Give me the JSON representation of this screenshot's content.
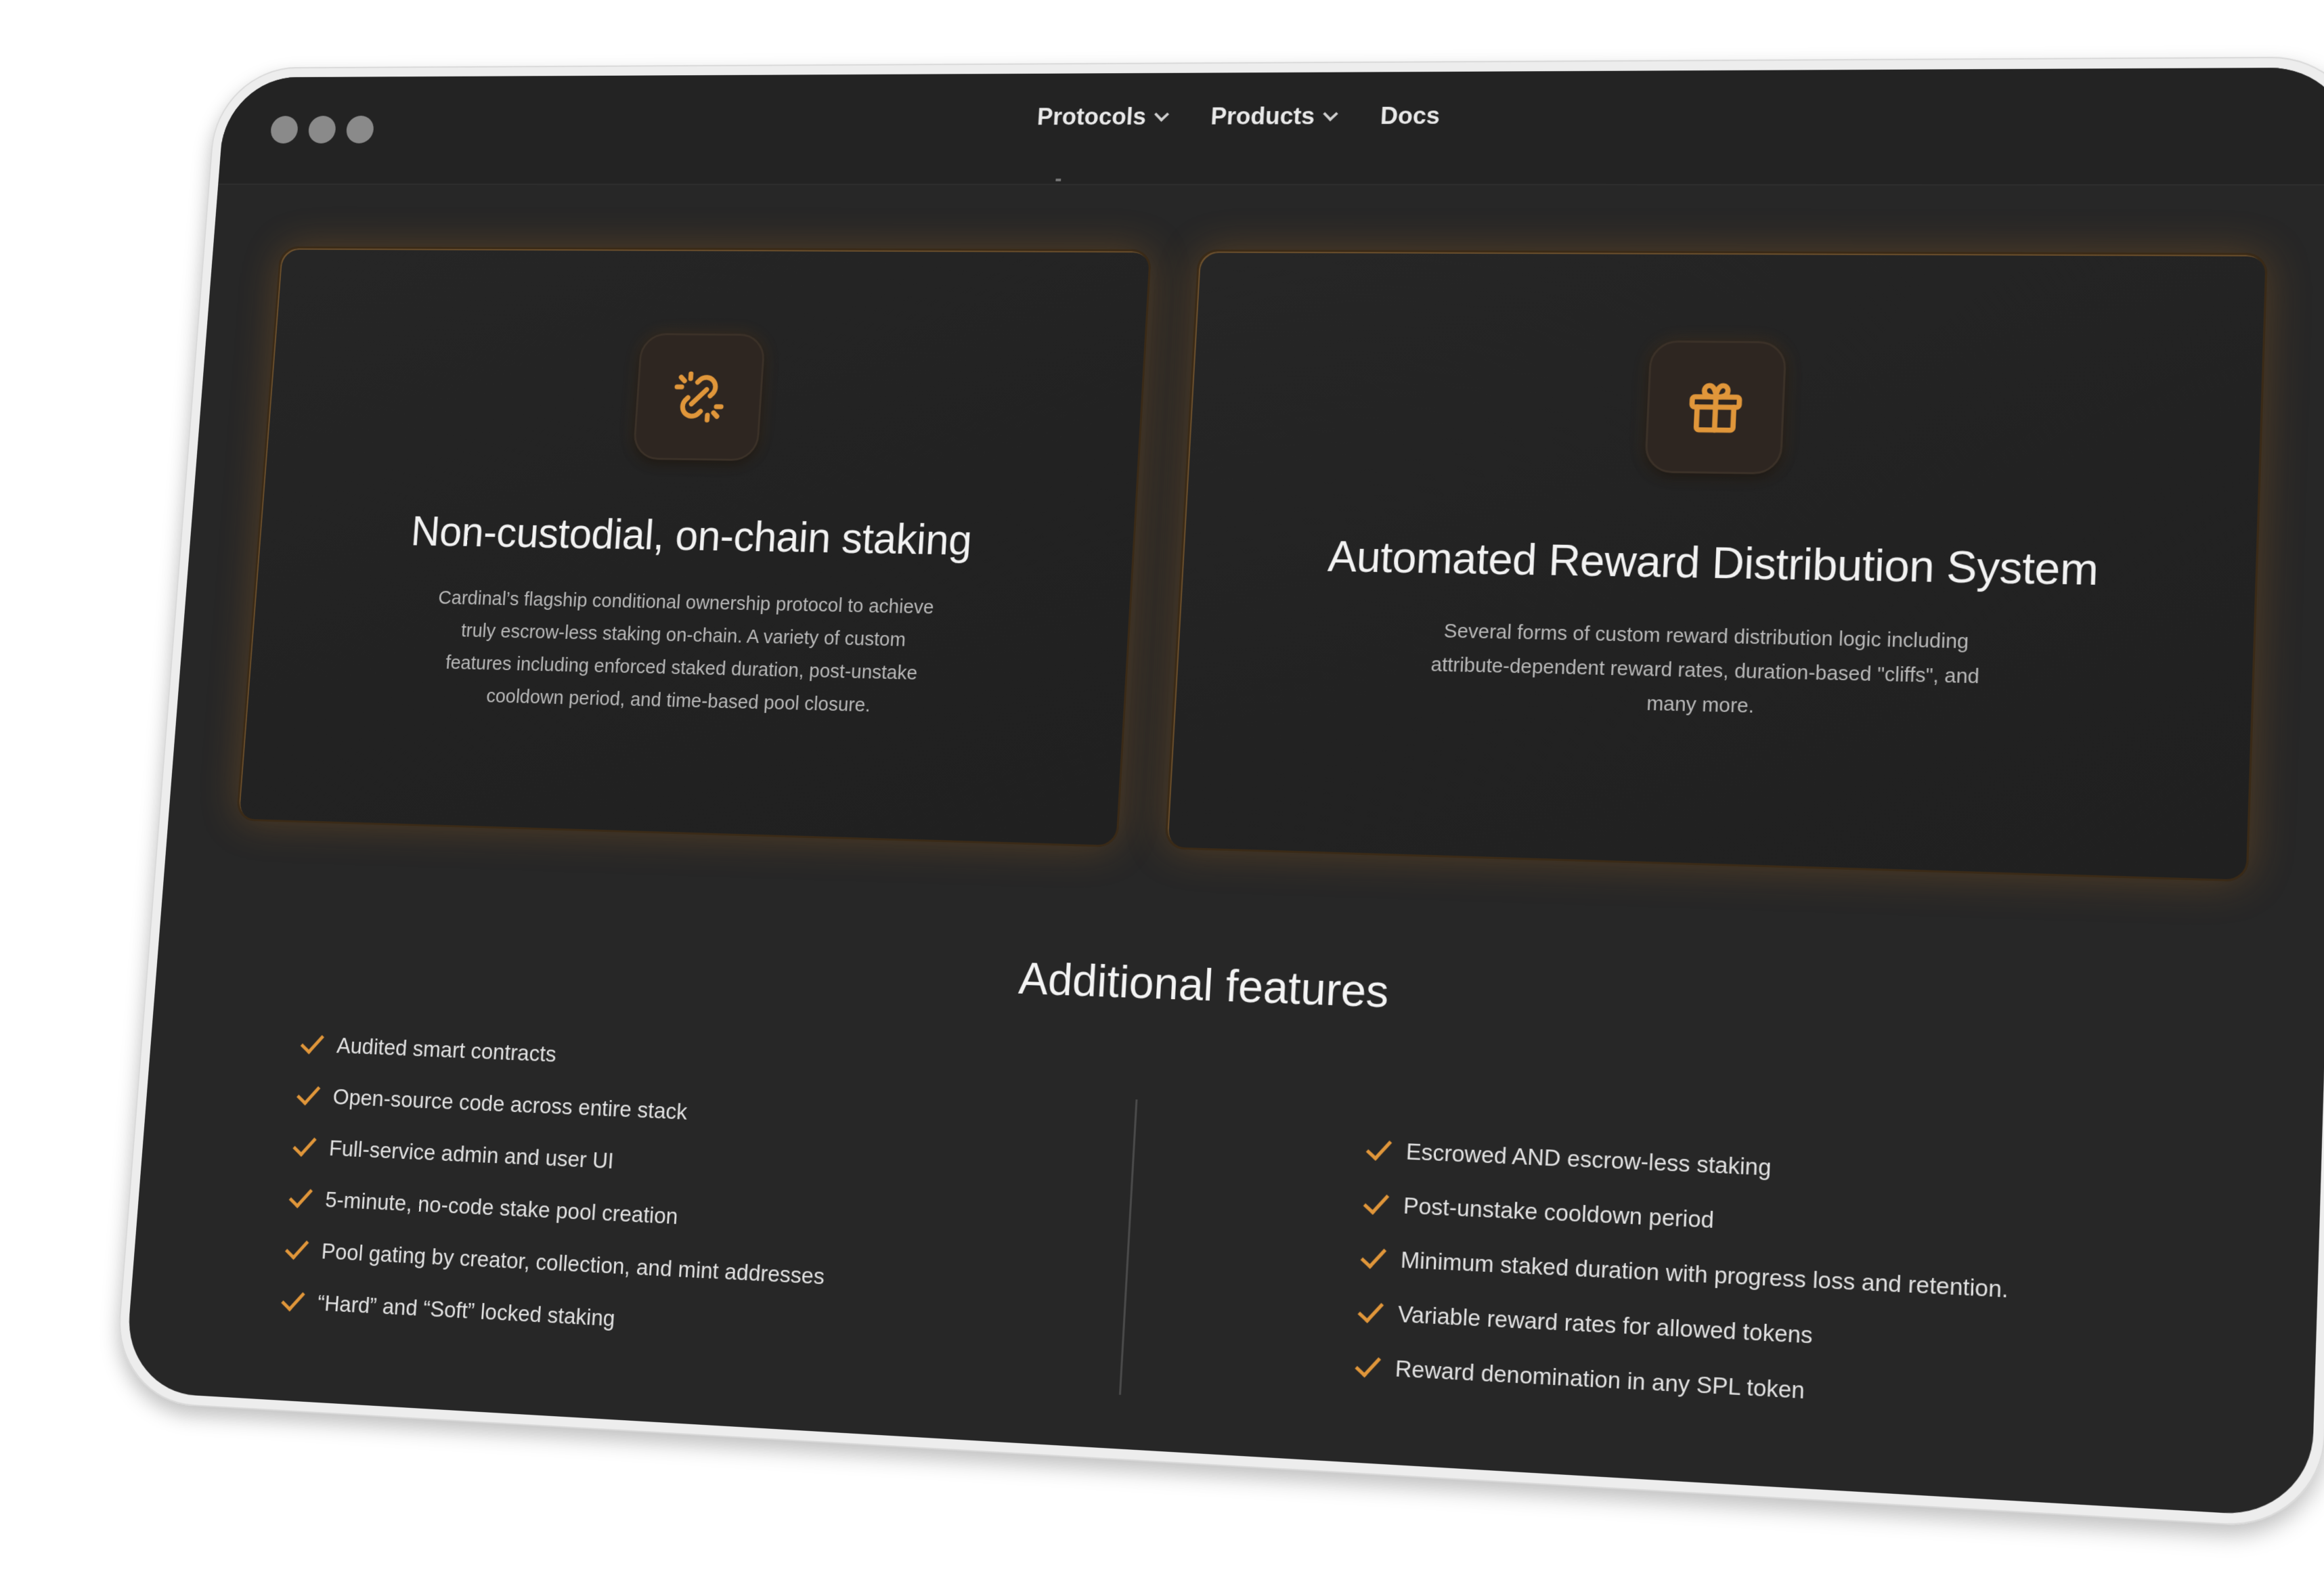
{
  "window": {
    "traffic_lights": [
      "close",
      "minimize",
      "maximize"
    ]
  },
  "nav": {
    "items": [
      {
        "label": "Protocols",
        "has_dropdown": true
      },
      {
        "label": "Products",
        "has_dropdown": true
      },
      {
        "label": "Docs",
        "has_dropdown": false
      }
    ]
  },
  "cards": [
    {
      "icon": "broken-link-icon",
      "title": "Non-custodial, on-chain staking",
      "description": "Cardinal’s flagship conditional ownership protocol to achieve truly escrow-less staking on-chain. A variety of custom features including enforced staked duration, post-unstake cooldown period, and time-based pool closure."
    },
    {
      "icon": "gift-icon",
      "title": "Automated Reward Distribution System",
      "description": "Several forms of custom reward distribution logic including attribute-dependent reward rates, duration-based \"cliffs\", and many more."
    }
  ],
  "additional": {
    "title": "Additional features",
    "left": [
      "Audited smart contracts",
      "Open-source code across entire stack",
      "Full-service admin and user UI",
      "5-minute, no-code stake pool creation",
      "Pool gating by creator, collection, and mint addresses",
      "“Hard” and “Soft” locked staking"
    ],
    "right": [
      "Escrowed AND escrow-less staking",
      "Post-unstake cooldown period",
      "Minimum staked duration with progress loss and retention.",
      "Variable reward rates for allowed tokens",
      "Reward denomination in any SPL token"
    ]
  },
  "colors": {
    "accent": "#e0963a",
    "background": "#272727",
    "card_glow": "#cd7d23"
  }
}
